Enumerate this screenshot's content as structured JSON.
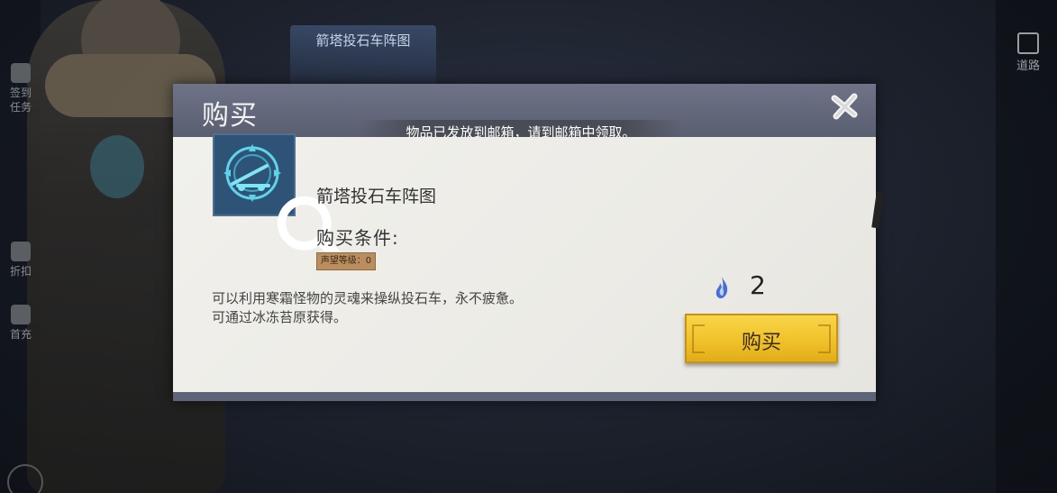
{
  "background": {
    "top_tab_label": "箭塔投石车阵图",
    "left_menu": [
      {
        "label": "签到\n任务",
        "icon": "checkin-icon"
      },
      {
        "label": "折扣",
        "icon": "discount-icon"
      },
      {
        "label": "首充",
        "icon": "first-charge-icon"
      }
    ],
    "right_button_label": "道路"
  },
  "dialog": {
    "title": "购买",
    "notice": "物品已发放到邮箱，请到邮箱中领取。",
    "close_icon": "close-icon",
    "item": {
      "name": "箭塔投石车阵图",
      "icon": "catapult-blueprint-icon",
      "condition_label": "购买条件:",
      "condition_badge": "声望等级：0",
      "description_line1": "可以利用寒霜怪物的灵魂来操纵投石车，永不疲惫。",
      "description_line2": "可通过冰冻苔原获得。"
    },
    "price": {
      "icon": "blue-flame-soul-icon",
      "value": "2"
    },
    "buy_button_label": "购买"
  },
  "colors": {
    "header": "#6f7387",
    "body": "#eeece6",
    "buy_button": "#f0c22a",
    "badge": "#bb8e5f"
  }
}
